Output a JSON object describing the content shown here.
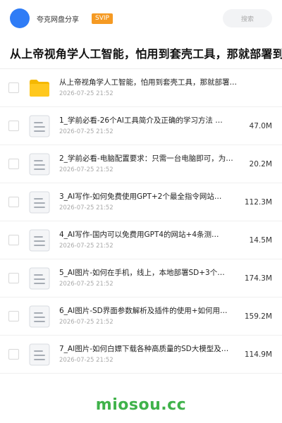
{
  "header": {
    "app_name": "夸克网盘分享",
    "badge": "SVIP",
    "search_placeholder": "搜索",
    "accent_color": "#2f7cf6",
    "badge_color": "#f59a23"
  },
  "folder": {
    "title": "从上帝视角学人工智能，怕用到套壳工具，那就部署到本地"
  },
  "files": [
    {
      "name": "从上帝视角学人工智能，怕用到套壳工具，那就部署到本地",
      "date": "2026-07-25 21:52",
      "size": "",
      "icon": "folder-icon"
    },
    {
      "name": "1_学前必看-26个AI工具简介及正确的学习方法 …",
      "date": "2026-07-25 21:52",
      "size": "47.0M",
      "icon": "document-icon"
    },
    {
      "name": "2_学前必看-电脑配置要求：只需一台电脑即可，为何…",
      "date": "2026-07-25 21:52",
      "size": "20.2M",
      "icon": "document-icon"
    },
    {
      "name": "3_AI写作-如何免费使用GPT+2个最全指令网站…",
      "date": "2026-07-25 21:52",
      "size": "112.3M",
      "icon": "document-icon"
    },
    {
      "name": "4_AI写作-国内可以免费用GPT4的网站+4条测…",
      "date": "2026-07-25 21:52",
      "size": "14.5M",
      "icon": "document-icon"
    },
    {
      "name": "5_AI图片-如何在手机，线上，本地部署SD+3个…",
      "date": "2026-07-25 21:52",
      "size": "174.3M",
      "icon": "document-icon"
    },
    {
      "name": "6_AI图片-SD界面参数解析及插件的使用+如何用…",
      "date": "2026-07-25 21:52",
      "size": "159.2M",
      "icon": "document-icon"
    },
    {
      "name": "7_AI图片-如何白嫖下载各种高质量的SD大模型及…",
      "date": "2026-07-25 21:52",
      "size": "114.9M",
      "icon": "document-icon"
    }
  ],
  "watermark": {
    "text": "miosou.cc",
    "color": "#3fb24a"
  }
}
